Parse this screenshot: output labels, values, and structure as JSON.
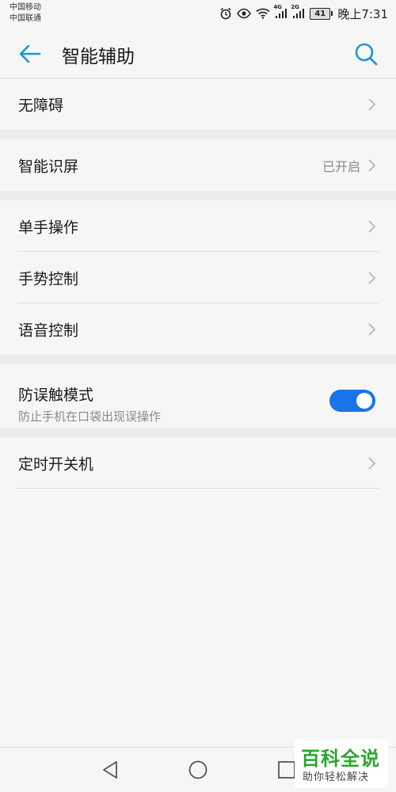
{
  "status_bar": {
    "carrier1": "中国移动",
    "carrier2": "中国联通",
    "signal1_label": "4G",
    "signal2_label": "2G",
    "battery": "41",
    "time": "晚上7:31",
    "icons": [
      "alarm-icon",
      "eye-icon",
      "wifi-icon",
      "signal-icon",
      "signal-icon"
    ]
  },
  "header": {
    "title": "智能辅助",
    "back_icon": "arrow-left-icon",
    "search_icon": "search-icon"
  },
  "groups": {
    "g1": {
      "items": [
        {
          "label": "无障碍"
        }
      ]
    },
    "g2": {
      "items": [
        {
          "label": "智能识屏",
          "value": "已开启"
        }
      ]
    },
    "g3": {
      "items": [
        {
          "label": "单手操作"
        },
        {
          "label": "手势控制"
        },
        {
          "label": "语音控制"
        }
      ]
    },
    "g4": {
      "title": "防误触模式",
      "subtitle": "防止手机在口袋出现误操作",
      "toggle_on": true
    },
    "g5": {
      "items": [
        {
          "label": "定时开关机"
        }
      ]
    }
  },
  "nav_bar": {
    "icons": [
      "nav-back-icon",
      "nav-home-icon",
      "nav-recent-icon"
    ]
  },
  "watermark": {
    "title": "百科全说",
    "subtitle": "助你轻松解决"
  },
  "colors": {
    "accent": "#1a73e8",
    "icon_blue": "#2196d3",
    "watermark_green": "#2aa52e"
  }
}
